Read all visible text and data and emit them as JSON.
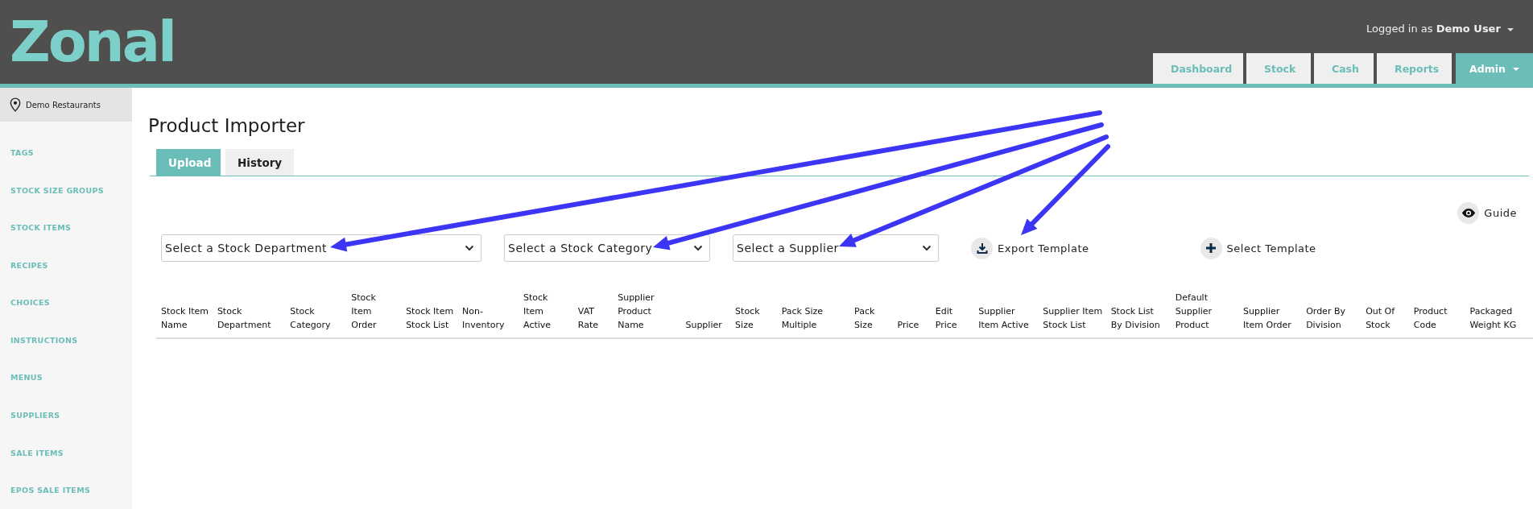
{
  "header": {
    "logo": "Zonal",
    "user_prefix": "Logged in as",
    "user_name": "Demo User",
    "nav": [
      {
        "label": "Dashboard",
        "selected": false,
        "has_caret": false
      },
      {
        "label": "Stock",
        "selected": false,
        "has_caret": false
      },
      {
        "label": "Cash",
        "selected": false,
        "has_caret": false
      },
      {
        "label": "Reports",
        "selected": false,
        "has_caret": false
      },
      {
        "label": "Admin",
        "selected": true,
        "has_caret": true
      }
    ]
  },
  "sidebar": {
    "location": "Demo Restaurants",
    "items": [
      "TAGS",
      "STOCK SIZE GROUPS",
      "STOCK ITEMS",
      "RECIPES",
      "CHOICES",
      "INSTRUCTIONS",
      "MENUS",
      "SUPPLIERS",
      "SALE ITEMS",
      "EPOS SALE ITEMS"
    ]
  },
  "page": {
    "title": "Product Importer",
    "tabs": [
      {
        "label": "Upload",
        "selected": true
      },
      {
        "label": "History",
        "selected": false
      }
    ],
    "guide": "Guide",
    "selects": [
      "Select a Stock Department",
      "Select a Stock Category",
      "Select a Supplier"
    ],
    "actions": [
      {
        "kind": "download",
        "label": "Export Template"
      },
      {
        "kind": "add",
        "label": "Select Template"
      }
    ]
  },
  "table": {
    "columns": [
      "Stock Item Name",
      "Stock Department",
      "Stock Category",
      "Stock Item Order",
      "Stock Item Stock List",
      "Non-Inventory",
      "Stock Item Active",
      "VAT Rate",
      "Supplier Product Name",
      "Supplier",
      "Stock Size",
      "Pack Size Multiple",
      "Pack Size",
      "Price",
      "Edit Price",
      "Supplier Item Active",
      "Supplier Item Stock List",
      "Stock List By Division",
      "Default Supplier Product",
      "Supplier Item Order",
      "Order By Division",
      "Out Of Stock",
      "Product Code",
      "Packaged Weight KG"
    ]
  }
}
